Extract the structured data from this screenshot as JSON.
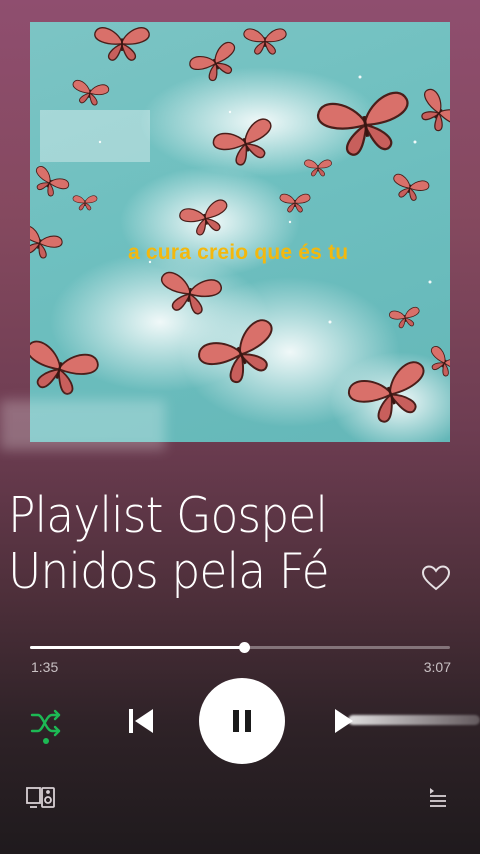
{
  "album": {
    "overlay_text": "a cura creio que és tu",
    "overlay_color": "#f3b80e"
  },
  "track": {
    "title_line1": "Playlist Gospel",
    "title_line2": "Unidos pela Fé",
    "liked": false
  },
  "playback": {
    "elapsed": "1:35",
    "total": "3:07",
    "progress_fraction": 0.51,
    "state": "playing",
    "shuffle_on": true
  },
  "colors": {
    "accent_green": "#1db954",
    "background_top": "#8f4e6f",
    "background_bottom": "#1f1a1d"
  },
  "icons": {
    "like": "heart-outline-icon",
    "shuffle": "shuffle-icon",
    "previous": "skip-previous-icon",
    "pause": "pause-icon",
    "next": "skip-next-icon",
    "devices": "connect-devices-icon",
    "queue": "queue-icon"
  }
}
